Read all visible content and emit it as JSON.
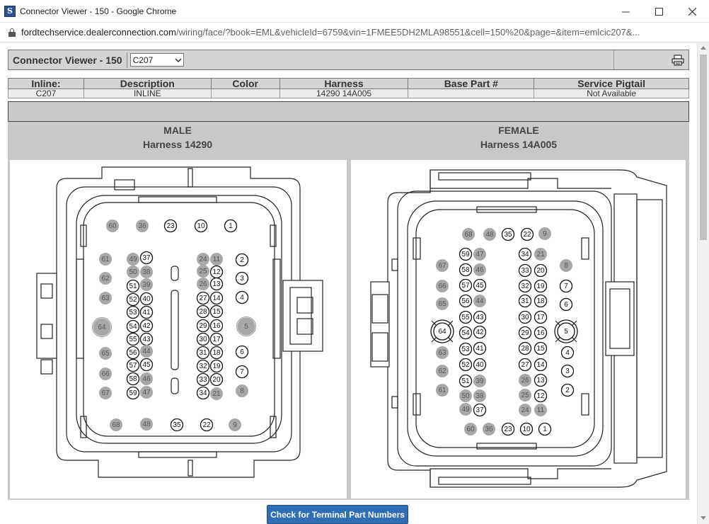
{
  "window": {
    "title": "Connector Viewer - 150 - Google Chrome",
    "url_domain": "fordtechservice.dealerconnection.com",
    "url_path": "/wiring/face/?book=EML&vehicleId=6759&vin=1FMEE5DH2MLA98551&cell=150%20&page=&item=emlcic207&..."
  },
  "viewer": {
    "title": "Connector Viewer - 150",
    "selected_connector": "C207"
  },
  "info_table": {
    "headers": [
      "Inline:",
      "Description",
      "Color",
      "Harness",
      "Base Part #",
      "Service Pigtail"
    ],
    "row": [
      "C207",
      "INLINE",
      "",
      "14290 14A005",
      "",
      "Not Available"
    ]
  },
  "male": {
    "label": "MALE",
    "harness": "Harness 14290"
  },
  "female": {
    "label": "FEMALE",
    "harness": "Harness 14A005"
  },
  "check_button": "Check for Terminal Part Numbers",
  "colors": {
    "pin_inactive": "#a8a8a8",
    "button": "#2f6db5",
    "panel_bg": "#c8c8c8"
  },
  "male_pins": [
    {
      "n": "60",
      "a": false
    },
    {
      "n": "36",
      "a": false
    },
    {
      "n": "23",
      "a": true
    },
    {
      "n": "10",
      "a": true
    },
    {
      "n": "1",
      "a": true
    },
    {
      "n": "61",
      "a": false
    },
    {
      "n": "49",
      "a": false
    },
    {
      "n": "37",
      "a": true
    },
    {
      "n": "24",
      "a": false
    },
    {
      "n": "11",
      "a": false
    },
    {
      "n": "2",
      "a": true
    },
    {
      "n": "62",
      "a": false
    },
    {
      "n": "50",
      "a": false
    },
    {
      "n": "38",
      "a": false
    },
    {
      "n": "25",
      "a": false
    },
    {
      "n": "12",
      "a": true
    },
    {
      "n": "3",
      "a": true
    },
    {
      "n": "51",
      "a": true
    },
    {
      "n": "39",
      "a": false
    },
    {
      "n": "26",
      "a": false
    },
    {
      "n": "13",
      "a": true
    },
    {
      "n": "63",
      "a": false
    },
    {
      "n": "52",
      "a": true
    },
    {
      "n": "40",
      "a": true
    },
    {
      "n": "27",
      "a": true
    },
    {
      "n": "14",
      "a": true
    },
    {
      "n": "4",
      "a": true
    },
    {
      "n": "53",
      "a": true
    },
    {
      "n": "41",
      "a": true
    },
    {
      "n": "28",
      "a": true
    },
    {
      "n": "15",
      "a": true
    },
    {
      "n": "64",
      "a": false
    },
    {
      "n": "54",
      "a": true
    },
    {
      "n": "42",
      "a": true
    },
    {
      "n": "29",
      "a": true
    },
    {
      "n": "16",
      "a": true
    },
    {
      "n": "5",
      "a": false
    },
    {
      "n": "55",
      "a": true
    },
    {
      "n": "43",
      "a": true
    },
    {
      "n": "30",
      "a": true
    },
    {
      "n": "17",
      "a": true
    },
    {
      "n": "65",
      "a": false
    },
    {
      "n": "56",
      "a": true
    },
    {
      "n": "44",
      "a": false
    },
    {
      "n": "31",
      "a": true
    },
    {
      "n": "18",
      "a": true
    },
    {
      "n": "6",
      "a": true
    },
    {
      "n": "57",
      "a": true
    },
    {
      "n": "45",
      "a": true
    },
    {
      "n": "32",
      "a": true
    },
    {
      "n": "19",
      "a": true
    },
    {
      "n": "66",
      "a": false
    },
    {
      "n": "58",
      "a": true
    },
    {
      "n": "46",
      "a": false
    },
    {
      "n": "33",
      "a": true
    },
    {
      "n": "20",
      "a": true
    },
    {
      "n": "7",
      "a": true
    },
    {
      "n": "67",
      "a": false
    },
    {
      "n": "59",
      "a": true
    },
    {
      "n": "47",
      "a": false
    },
    {
      "n": "34",
      "a": true
    },
    {
      "n": "21",
      "a": false
    },
    {
      "n": "8",
      "a": false
    },
    {
      "n": "68",
      "a": false
    },
    {
      "n": "48",
      "a": false
    },
    {
      "n": "35",
      "a": true
    },
    {
      "n": "22",
      "a": true
    },
    {
      "n": "9",
      "a": false
    }
  ],
  "female_pins": [
    {
      "n": "68",
      "a": false
    },
    {
      "n": "48",
      "a": false
    },
    {
      "n": "35",
      "a": true
    },
    {
      "n": "22",
      "a": true
    },
    {
      "n": "9",
      "a": false
    },
    {
      "n": "59",
      "a": true
    },
    {
      "n": "47",
      "a": false
    },
    {
      "n": "34",
      "a": true
    },
    {
      "n": "21",
      "a": false
    },
    {
      "n": "67",
      "a": false
    },
    {
      "n": "58",
      "a": true
    },
    {
      "n": "46",
      "a": false
    },
    {
      "n": "33",
      "a": true
    },
    {
      "n": "20",
      "a": true
    },
    {
      "n": "8",
      "a": false
    },
    {
      "n": "66",
      "a": false
    },
    {
      "n": "57",
      "a": true
    },
    {
      "n": "45",
      "a": true
    },
    {
      "n": "32",
      "a": true
    },
    {
      "n": "19",
      "a": true
    },
    {
      "n": "7",
      "a": true
    },
    {
      "n": "65",
      "a": false
    },
    {
      "n": "56",
      "a": true
    },
    {
      "n": "44",
      "a": false
    },
    {
      "n": "31",
      "a": true
    },
    {
      "n": "18",
      "a": true
    },
    {
      "n": "6",
      "a": true
    },
    {
      "n": "55",
      "a": true
    },
    {
      "n": "43",
      "a": true
    },
    {
      "n": "30",
      "a": true
    },
    {
      "n": "17",
      "a": true
    },
    {
      "n": "64",
      "a": true
    },
    {
      "n": "54",
      "a": true
    },
    {
      "n": "42",
      "a": true
    },
    {
      "n": "29",
      "a": true
    },
    {
      "n": "16",
      "a": true
    },
    {
      "n": "5",
      "a": true
    },
    {
      "n": "53",
      "a": true
    },
    {
      "n": "41",
      "a": true
    },
    {
      "n": "28",
      "a": true
    },
    {
      "n": "15",
      "a": true
    },
    {
      "n": "4",
      "a": true
    },
    {
      "n": "63",
      "a": false
    },
    {
      "n": "52",
      "a": true
    },
    {
      "n": "40",
      "a": true
    },
    {
      "n": "27",
      "a": true
    },
    {
      "n": "14",
      "a": true
    },
    {
      "n": "3",
      "a": true
    },
    {
      "n": "62",
      "a": false
    },
    {
      "n": "51",
      "a": true
    },
    {
      "n": "39",
      "a": false
    },
    {
      "n": "26",
      "a": false
    },
    {
      "n": "13",
      "a": true
    },
    {
      "n": "61",
      "a": false
    },
    {
      "n": "50",
      "a": false
    },
    {
      "n": "38",
      "a": false
    },
    {
      "n": "25",
      "a": false
    },
    {
      "n": "12",
      "a": true
    },
    {
      "n": "2",
      "a": true
    },
    {
      "n": "49",
      "a": false
    },
    {
      "n": "37",
      "a": true
    },
    {
      "n": "24",
      "a": false
    },
    {
      "n": "11",
      "a": false
    },
    {
      "n": "60",
      "a": false
    },
    {
      "n": "36",
      "a": false
    },
    {
      "n": "23",
      "a": true
    },
    {
      "n": "10",
      "a": true
    },
    {
      "n": "1",
      "a": true
    }
  ]
}
